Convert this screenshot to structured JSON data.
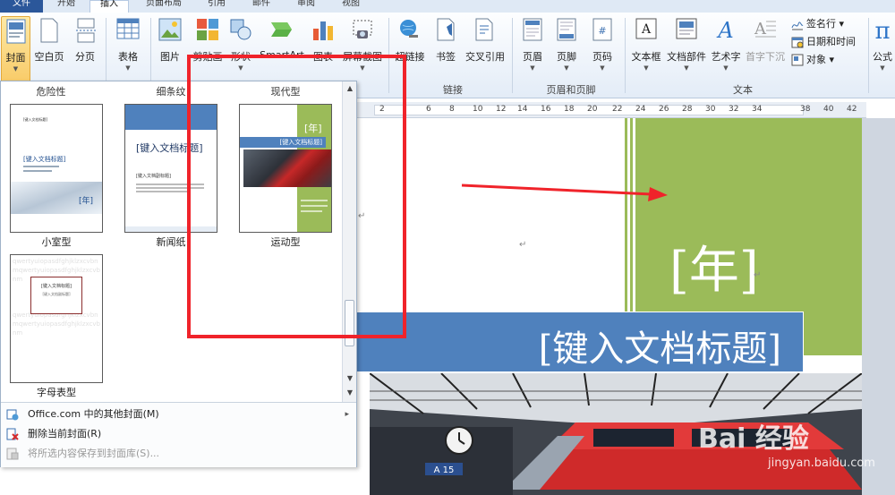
{
  "tabs": [
    "文件",
    "开始",
    "插入",
    "页面布局",
    "引用",
    "邮件",
    "审阅",
    "视图"
  ],
  "ribbon": {
    "cover": "封面",
    "blank": "空白页",
    "pagebreak": "分页",
    "table": "表格",
    "picture": "图片",
    "clipart": "剪贴画",
    "shapes": "形状",
    "smartart": "SmartArt",
    "chart": "图表",
    "screenshot": "屏幕截图",
    "hyperlink": "超链接",
    "bookmark": "书签",
    "crossref": "交叉引用",
    "header": "页眉",
    "footer": "页脚",
    "pagenum": "页码",
    "textbox": "文本框",
    "docparts": "文档部件",
    "wordart": "艺术字",
    "dropcap": "首字下沉",
    "signature": "签名行",
    "datetime": "日期和时间",
    "object": "对象",
    "formula": "公式",
    "group_links": "链接",
    "group_headerfooter": "页眉和页脚",
    "group_text": "文本"
  },
  "gallery": {
    "headers": [
      "危险性",
      "细条纹",
      "现代型"
    ],
    "thumbs": [
      "小室型",
      "新闻纸",
      "运动型",
      "字母表型"
    ],
    "t1_title": "[键入文档标题]",
    "t1_small": "[键入文档标题]",
    "t1_year": "[年]",
    "t2_title": "[键入文档标题]",
    "t2_sub": "[键入文档副标题]",
    "t3_year": "[年]",
    "t3_title": "[键入文档标题]",
    "t4_title": "[键入文档标题]",
    "t4_sub": "[键入文档副标题]",
    "t4_bg": "qwertyuiopasdfghjklzxcvbnmqwertyuiopasdfghjklzxcvbnm",
    "menu": {
      "more": "Office.com 中的其他封面(M)",
      "remove": "删除当前封面(R)",
      "save": "将所选内容保存到封面库(S)..."
    }
  },
  "ruler_ticks": [
    "2",
    "6",
    "8",
    "10",
    "12",
    "14",
    "16",
    "18",
    "20",
    "22",
    "24",
    "26",
    "28",
    "30",
    "32",
    "34",
    "38",
    "40",
    "42"
  ],
  "doc": {
    "year": "[年]",
    "title": "[键入文档标题]",
    "platform": "A 15"
  },
  "watermark": {
    "brand": "Bai 经验",
    "url": "jingyan.baidu.com"
  },
  "colors": {
    "green": "#9bbb59",
    "blue": "#4f81bd",
    "highlight_red": "#f0232a"
  }
}
